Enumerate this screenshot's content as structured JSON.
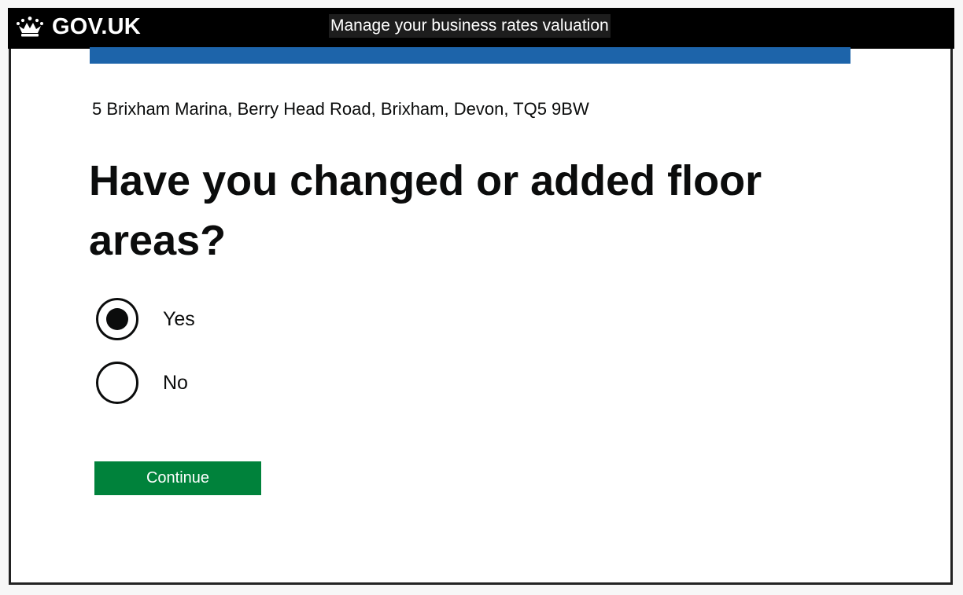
{
  "header": {
    "logo_text": "GOV.UK",
    "logo_icon": "crown-icon",
    "service_name": "Manage your business rates valuation"
  },
  "colors": {
    "header_bg": "#000000",
    "accent_bar": "#1d64aa",
    "button_bg": "#00823b",
    "text": "#0b0c0c"
  },
  "main": {
    "address": "5 Brixham Marina, Berry Head Road, Brixham, Devon, TQ5 9BW",
    "question": "Have you changed or added floor areas?",
    "options": [
      {
        "label": "Yes",
        "selected": true
      },
      {
        "label": "No",
        "selected": false
      }
    ],
    "continue_label": "Continue"
  }
}
